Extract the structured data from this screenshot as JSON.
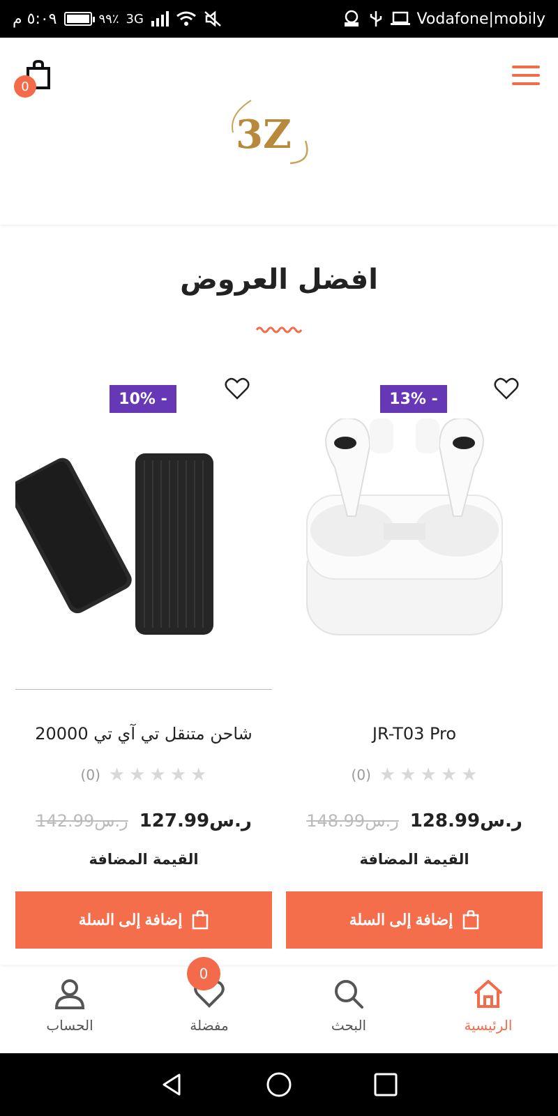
{
  "status_bar": {
    "time": "٥:٠٩ م",
    "battery": "٩٩٪",
    "network": "3G",
    "carrier": "Vodafone|mobily"
  },
  "header": {
    "cart_count": "0",
    "logo_text": "3Z"
  },
  "section": {
    "title": "افضل العروض"
  },
  "products": [
    {
      "name": "JR-T03 Pro",
      "discount": "13% -",
      "rating_count": "(0)",
      "price": "128.99",
      "old_price": "148.99",
      "currency": "ر.س",
      "vat": "القيمة المضافة",
      "add_label": "إضافة إلى السلة"
    },
    {
      "name": "شاحن متنقل تي آي تي 20000",
      "discount": "10% -",
      "rating_count": "(0)",
      "price": "127.99",
      "old_price": "142.99",
      "currency": "ر.س",
      "vat": "القيمة المضافة",
      "add_label": "إضافة إلى السلة"
    }
  ],
  "bottom_nav": {
    "home": "الرئيسية",
    "search": "البحث",
    "favorites": "مفضلة",
    "favorites_count": "0",
    "account": "الحساب"
  },
  "colors": {
    "accent": "#f46e4c",
    "badge": "#6638b6"
  }
}
